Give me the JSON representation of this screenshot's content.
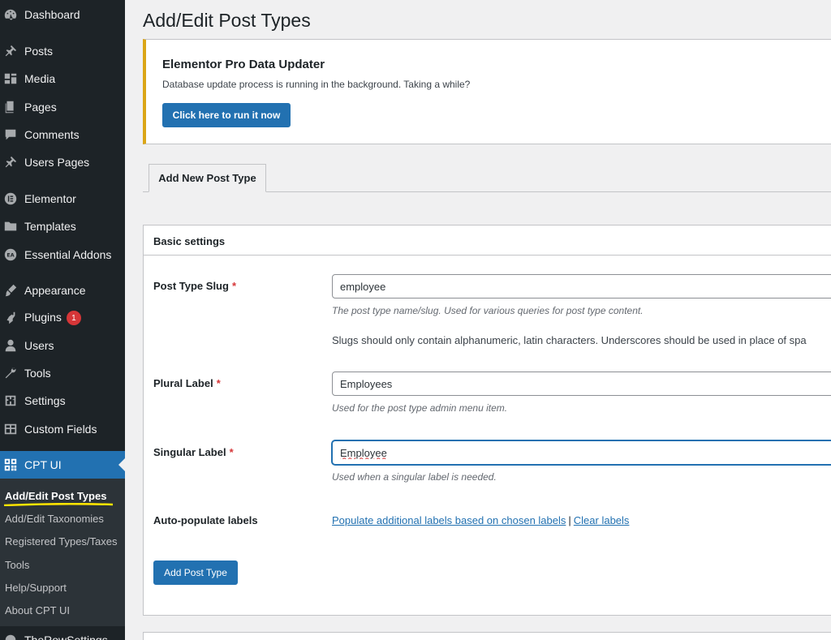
{
  "sidebar": {
    "items": [
      {
        "label": "Dashboard",
        "icon": "dashboard-icon"
      },
      {
        "label": "Posts",
        "icon": "pin-icon"
      },
      {
        "label": "Media",
        "icon": "media-icon"
      },
      {
        "label": "Pages",
        "icon": "pages-icon"
      },
      {
        "label": "Comments",
        "icon": "comment-icon"
      },
      {
        "label": "Users Pages",
        "icon": "pin-icon"
      },
      {
        "label": "Elementor",
        "icon": "elementor-icon"
      },
      {
        "label": "Templates",
        "icon": "folder-icon"
      },
      {
        "label": "Essential Addons",
        "icon": "ea-icon"
      },
      {
        "label": "Appearance",
        "icon": "brush-icon"
      },
      {
        "label": "Plugins",
        "icon": "plugin-icon",
        "badge": "1"
      },
      {
        "label": "Users",
        "icon": "user-icon"
      },
      {
        "label": "Tools",
        "icon": "wrench-icon"
      },
      {
        "label": "Settings",
        "icon": "settings-icon"
      },
      {
        "label": "Custom Fields",
        "icon": "grid-icon"
      },
      {
        "label": "CPT UI",
        "icon": "cpt-icon"
      }
    ],
    "submenu": [
      "Add/Edit Post Types",
      "Add/Edit Taxonomies",
      "Registered Types/Taxes",
      "Tools",
      "Help/Support",
      "About CPT UI"
    ],
    "partial_item": "TheRowSettings",
    "accent": "#2271b1",
    "highlight_color": "#ffe600"
  },
  "page_title": "Add/Edit Post Types",
  "notice": {
    "title": "Elementor Pro Data Updater",
    "text": "Database update process is running in the background. Taking a while?",
    "button": "Click here to run it now",
    "border_color": "#dba617"
  },
  "tab": "Add New Post Type",
  "form": {
    "section_title": "Basic settings",
    "slug_label": "Post Type Slug",
    "slug_value": "employee",
    "slug_help": "The post type name/slug. Used for various queries for post type content.",
    "slug_note": "Slugs should only contain alphanumeric, latin characters. Underscores should be used in place of spa",
    "plural_label": "Plural Label",
    "plural_value": "Employees",
    "plural_help": "Used for the post type admin menu item.",
    "singular_label": "Singular Label",
    "singular_value": "Employee",
    "singular_help": "Used when a singular label is needed.",
    "autopop_label": "Auto-populate labels",
    "populate_link": "Populate additional labels based on chosen labels",
    "clear_link": "Clear labels",
    "link_separator": "|",
    "required_mark": "*",
    "submit": "Add Post Type"
  }
}
